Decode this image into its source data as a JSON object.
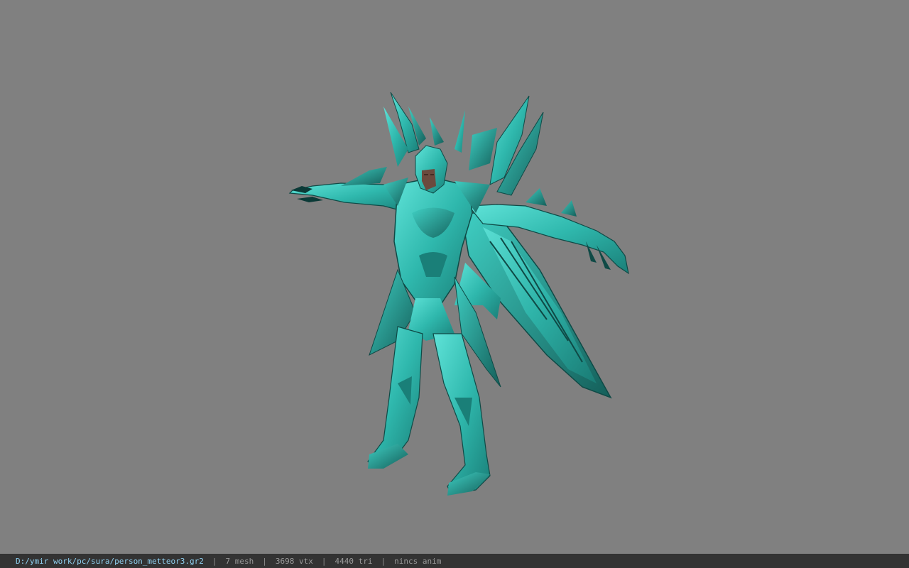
{
  "viewer": {
    "background_color": "#808080",
    "model_color": "#35c2b8",
    "model_subject": "armored-character-model"
  },
  "status_bar": {
    "file_path": "D:/ymir work/pc/sura/person_metteor3.gr2",
    "separator": "|",
    "mesh_count": "7 mesh",
    "vertex_count": "3698 vtx",
    "triangle_count": "4440 tri",
    "anim_status": "nincs anim",
    "path_color": "#8fd0f0",
    "text_color": "#9a9a9a",
    "bar_color": "#333333"
  }
}
